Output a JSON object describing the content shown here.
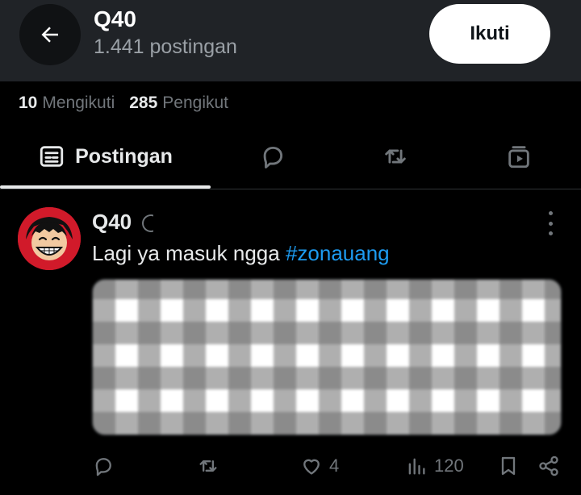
{
  "header": {
    "title": "Q40",
    "post_count": "1.441 postingan",
    "follow_label": "Ikuti"
  },
  "stats": {
    "following_count": "10",
    "following_label": "Mengikuti",
    "followers_count": "285",
    "followers_label": "Pengikut"
  },
  "tabs": {
    "active_label": "Postingan",
    "icons": [
      "list-icon",
      "reply-icon",
      "repost-icon",
      "media-play-icon"
    ]
  },
  "post": {
    "author": "Q40",
    "text": "Lagi ya masuk ngga ",
    "hashtag": "#zonauang",
    "likes": "4",
    "views": "120"
  },
  "colors": {
    "header_bg": "#202327",
    "background": "#000000",
    "accent": "#1d9bf0",
    "muted": "#71767b"
  }
}
